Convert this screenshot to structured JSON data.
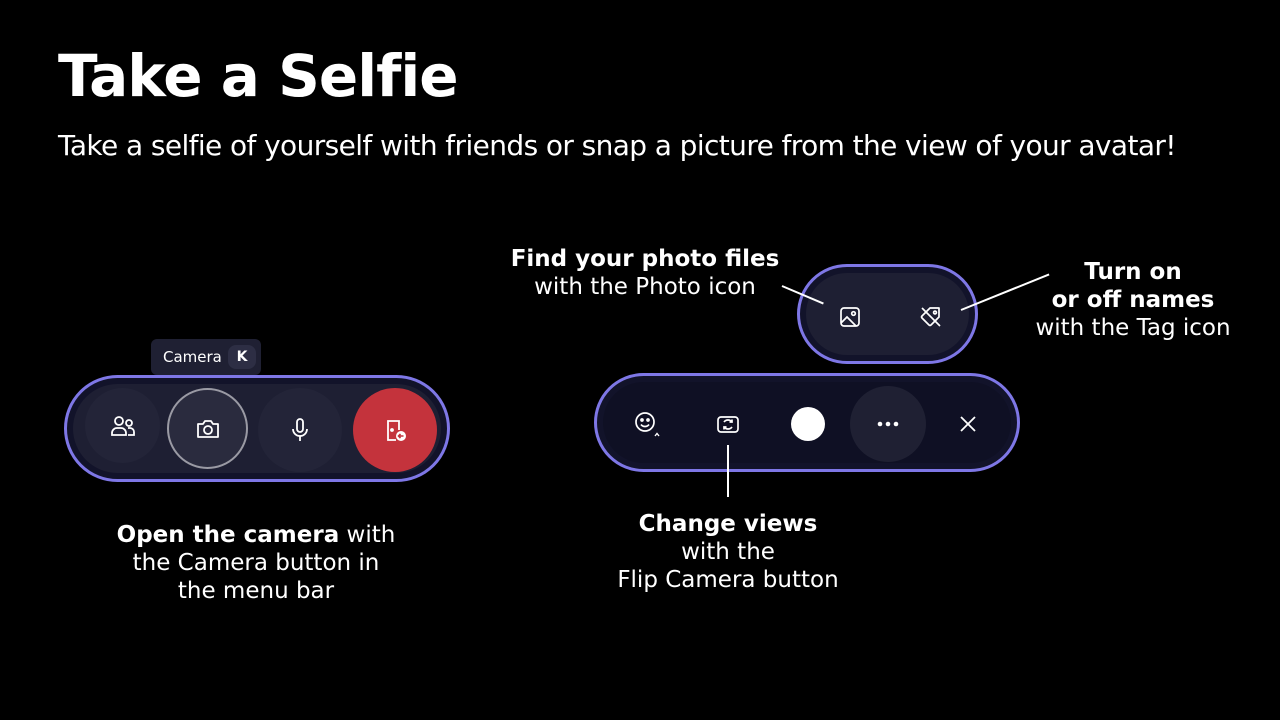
{
  "title": "Take a Selfie",
  "subtitle": "Take a selfie of yourself with friends or snap a picture from the view of your avatar!",
  "menu_bar": {
    "tooltip_label": "Camera",
    "tooltip_key": "K",
    "buttons": [
      {
        "name": "people",
        "icon": "people-icon"
      },
      {
        "name": "camera",
        "icon": "camera-icon"
      },
      {
        "name": "microphone",
        "icon": "microphone-icon"
      },
      {
        "name": "leave",
        "icon": "leave-icon"
      }
    ],
    "colors": {
      "accent": "#7e77e6",
      "leave": "#c4333c"
    }
  },
  "camera_toolbar": {
    "buttons": [
      {
        "name": "reactions",
        "icon": "smiley-icon"
      },
      {
        "name": "flip-camera",
        "icon": "flip-camera-icon"
      },
      {
        "name": "shutter",
        "icon": "shutter-icon"
      },
      {
        "name": "more",
        "icon": "more-icon"
      },
      {
        "name": "close",
        "icon": "close-icon"
      }
    ]
  },
  "photo_toolbar": {
    "buttons": [
      {
        "name": "photo",
        "icon": "photo-icon"
      },
      {
        "name": "tag",
        "icon": "tag-off-icon"
      }
    ]
  },
  "captions": {
    "open_camera": {
      "bold": "Open the camera",
      "line1_rest": " with",
      "line2": "the Camera button in",
      "line3": "the menu bar"
    },
    "photo_files": {
      "bold": "Find your photo files",
      "line2": "with the Photo icon"
    },
    "names": {
      "bold1": "Turn on",
      "bold2": "or off names",
      "line3": "with the Tag icon"
    },
    "change_views": {
      "bold": "Change views",
      "line2": "with the",
      "line3": "Flip Camera button"
    }
  }
}
